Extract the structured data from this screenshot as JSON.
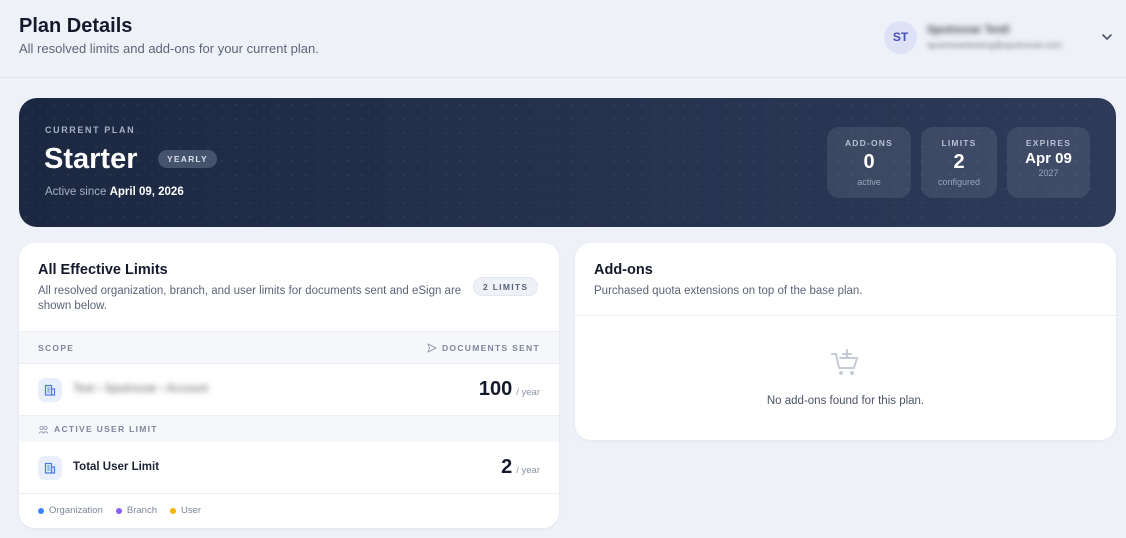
{
  "header": {
    "title": "Plan Details",
    "subtitle": "All resolved limits and add-ons for your current plan."
  },
  "user": {
    "initials": "ST",
    "name": "Sputnovar Testl",
    "email": "sputnovartestorg@sputnovar.com"
  },
  "plan": {
    "kicker": "CURRENT PLAN",
    "name": "Starter",
    "billing": "YEARLY",
    "active_since_label": "Active since",
    "active_since_date": "April 09, 2026",
    "stats": [
      {
        "label": "ADD-ONS",
        "value": "0",
        "sub": "active"
      },
      {
        "label": "LIMITS",
        "value": "2",
        "sub": "configured"
      },
      {
        "label": "EXPIRES",
        "value": "Apr 09",
        "sub": "2027"
      }
    ]
  },
  "limits": {
    "title": "All Effective Limits",
    "description": "All resolved organization, branch, and user limits for documents sent and eSign are shown below.",
    "badge": "2 LIMITS",
    "col_scope": "SCOPE",
    "col_docs": "DOCUMENTS SENT",
    "rows": [
      {
        "label": "Test › Sputnovar › Account",
        "value": "100",
        "unit": "/ year"
      }
    ],
    "section": "ACTIVE USER LIMIT",
    "user_rows": [
      {
        "label": "Total User Limit",
        "value": "2",
        "unit": "/ year"
      }
    ],
    "legend": [
      {
        "label": "Organization",
        "color": "#3b82f6"
      },
      {
        "label": "Branch",
        "color": "#8b5cf6"
      },
      {
        "label": "User",
        "color": "#f5b400"
      }
    ]
  },
  "addons": {
    "title": "Add-ons",
    "description": "Purchased quota extensions on top of the base plan.",
    "empty_text": "No add-ons found for this plan."
  }
}
